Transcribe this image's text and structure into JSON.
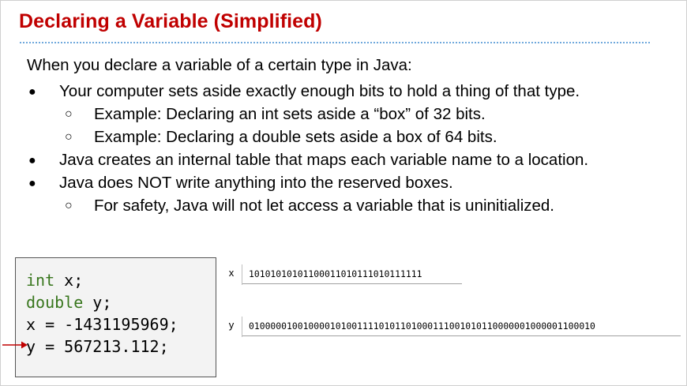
{
  "title": "Declaring a Variable (Simplified)",
  "intro": "When you declare a variable of a certain type in Java:",
  "bullets": [
    {
      "level": 1,
      "marker": "●",
      "text": "Your computer sets aside exactly enough bits to hold a thing of that type."
    },
    {
      "level": 2,
      "marker": "○",
      "text": "Example: Declaring an int sets aside a “box” of 32 bits."
    },
    {
      "level": 2,
      "marker": "○",
      "text": "Example: Declaring a double sets aside a box of 64 bits."
    },
    {
      "level": 1,
      "marker": "●",
      "text": "Java creates an internal table that maps each variable name to a location."
    },
    {
      "level": 1,
      "marker": "●",
      "text": "Java does NOT write anything into the reserved boxes."
    },
    {
      "level": 2,
      "marker": "○",
      "text": "For safety, Java will not let access a variable that is uninitialized."
    }
  ],
  "code": {
    "line1_kw": "int",
    "line1_rest": " x;",
    "line2_kw": "double",
    "line2_rest": " y;",
    "line3": "x = -1431195969;",
    "line4": "y = 567213.112;"
  },
  "memory": {
    "x": {
      "label": "x",
      "bits": "10101010101100011010111010111111"
    },
    "y": {
      "label": "y",
      "bits": "0100000100100001010011110101101000111001010110000001000001100010"
    }
  },
  "colors": {
    "title": "#c00000",
    "keyword": "#38761d",
    "arrow": "#c00000",
    "rule": "#6fa8dc"
  }
}
